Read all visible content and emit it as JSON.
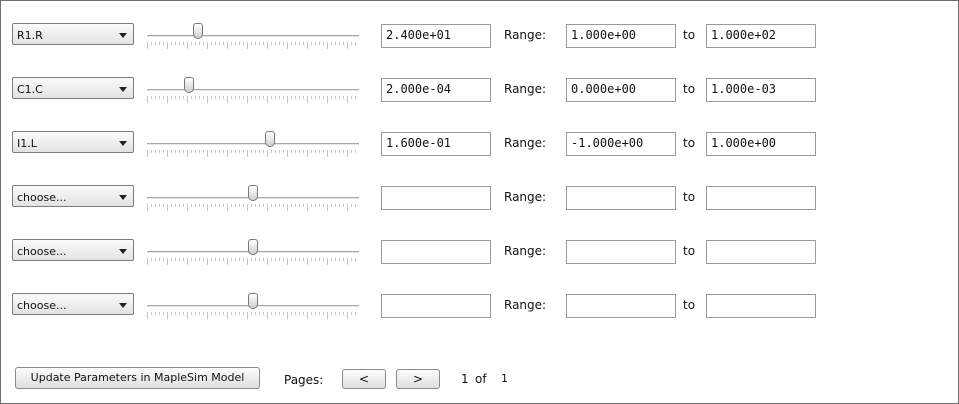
{
  "rows": [
    {
      "parameter": "R1.R",
      "slider_fraction": 0.24,
      "value": "2.400e+01",
      "range_label": "Range:",
      "min": "1.000e+00",
      "to_label": "to",
      "max": "1.000e+02"
    },
    {
      "parameter": "C1.C",
      "slider_fraction": 0.2,
      "value": "2.000e-04",
      "range_label": "Range:",
      "min": "0.000e+00",
      "to_label": "to",
      "max": "1.000e-03"
    },
    {
      "parameter": "I1.L",
      "slider_fraction": 0.58,
      "value": "1.600e-01",
      "range_label": "Range:",
      "min": "-1.000e+00",
      "to_label": "to",
      "max": "1.000e+00"
    },
    {
      "parameter": "choose...",
      "slider_fraction": 0.5,
      "value": "",
      "range_label": "Range:",
      "min": "",
      "to_label": "to",
      "max": ""
    },
    {
      "parameter": "choose...",
      "slider_fraction": 0.5,
      "value": "",
      "range_label": "Range:",
      "min": "",
      "to_label": "to",
      "max": ""
    },
    {
      "parameter": "choose...",
      "slider_fraction": 0.5,
      "value": "",
      "range_label": "Range:",
      "min": "",
      "to_label": "to",
      "max": ""
    }
  ],
  "footer": {
    "update_button": "Update Parameters in MapleSim Model",
    "pages_label": "Pages:",
    "prev_button": "<",
    "next_button": ">",
    "current_page": "1",
    "of_label": "of",
    "total_pages": "1"
  }
}
